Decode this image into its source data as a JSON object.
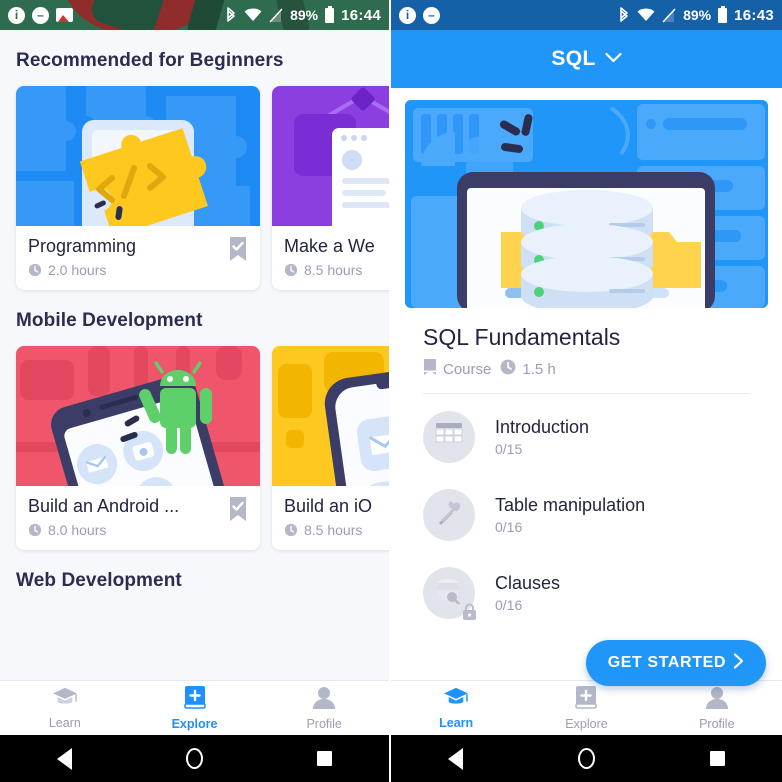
{
  "left_phone": {
    "status_bar": {
      "icons": [
        "info-icon",
        "do-not-disturb-icon",
        "image-icon",
        "bluetooth-icon",
        "wifi-icon",
        "signal-off-icon"
      ],
      "battery_percent": "89%",
      "time": "16:44"
    },
    "sections": [
      {
        "title": "Recommended for Beginners",
        "cards": [
          {
            "name": "Programming",
            "duration": "2.0 hours",
            "thumb": "puzzle-code-illustration",
            "bookmarked": true
          },
          {
            "name": "Make a We",
            "duration": "8.5 hours",
            "thumb": "website-builder-illustration",
            "bookmarked": false
          }
        ]
      },
      {
        "title": "Mobile Development",
        "cards": [
          {
            "name": "Build an Android ...",
            "duration": "8.0 hours",
            "thumb": "android-robot-illustration",
            "bookmarked": true
          },
          {
            "name": "Build an iO",
            "duration": "8.5 hours",
            "thumb": "ios-phone-illustration",
            "bookmarked": false
          }
        ]
      },
      {
        "title": "Web Development",
        "cards": []
      }
    ],
    "bottom_nav": {
      "active": "Explore",
      "items": [
        {
          "label": "Learn",
          "icon": "graduation-cap-icon"
        },
        {
          "label": "Explore",
          "icon": "book-plus-icon"
        },
        {
          "label": "Profile",
          "icon": "person-icon"
        }
      ]
    }
  },
  "right_phone": {
    "status_bar": {
      "icons": [
        "info-icon",
        "do-not-disturb-icon",
        "bluetooth-icon",
        "wifi-icon",
        "signal-off-icon"
      ],
      "battery_percent": "89%",
      "time": "16:43"
    },
    "app_bar": {
      "title": "SQL",
      "dropdown_icon": "chevron-down-icon"
    },
    "hero": {
      "illustration": "database-stack-illustration"
    },
    "course": {
      "title": "SQL Fundamentals",
      "type_label": "Course",
      "type_icon": "book-icon",
      "duration": "1.5 h",
      "duration_icon": "clock-icon"
    },
    "lessons": [
      {
        "title": "Introduction",
        "progress": "0/15",
        "icon": "table-grid-icon",
        "locked": false
      },
      {
        "title": "Table manipulation",
        "progress": "0/16",
        "icon": "tools-icon",
        "locked": false
      },
      {
        "title": "Clauses",
        "progress": "0/16",
        "icon": "database-search-icon",
        "locked": true
      }
    ],
    "cta": {
      "label": "GET STARTED",
      "arrow": "chevron-right-icon"
    },
    "bottom_nav": {
      "active": "Learn",
      "items": [
        {
          "label": "Learn",
          "icon": "graduation-cap-icon"
        },
        {
          "label": "Explore",
          "icon": "book-plus-icon"
        },
        {
          "label": "Profile",
          "icon": "person-icon"
        }
      ]
    }
  },
  "system_nav": {
    "buttons": [
      {
        "name": "back-button",
        "icon": "triangle-left-icon"
      },
      {
        "name": "home-button",
        "icon": "circle-icon"
      },
      {
        "name": "recents-button",
        "icon": "square-icon"
      }
    ]
  },
  "colors": {
    "accent": "#2196f9",
    "heading": "#2b2d50",
    "muted": "#9a9db4",
    "bg": "#f7f8fc"
  }
}
